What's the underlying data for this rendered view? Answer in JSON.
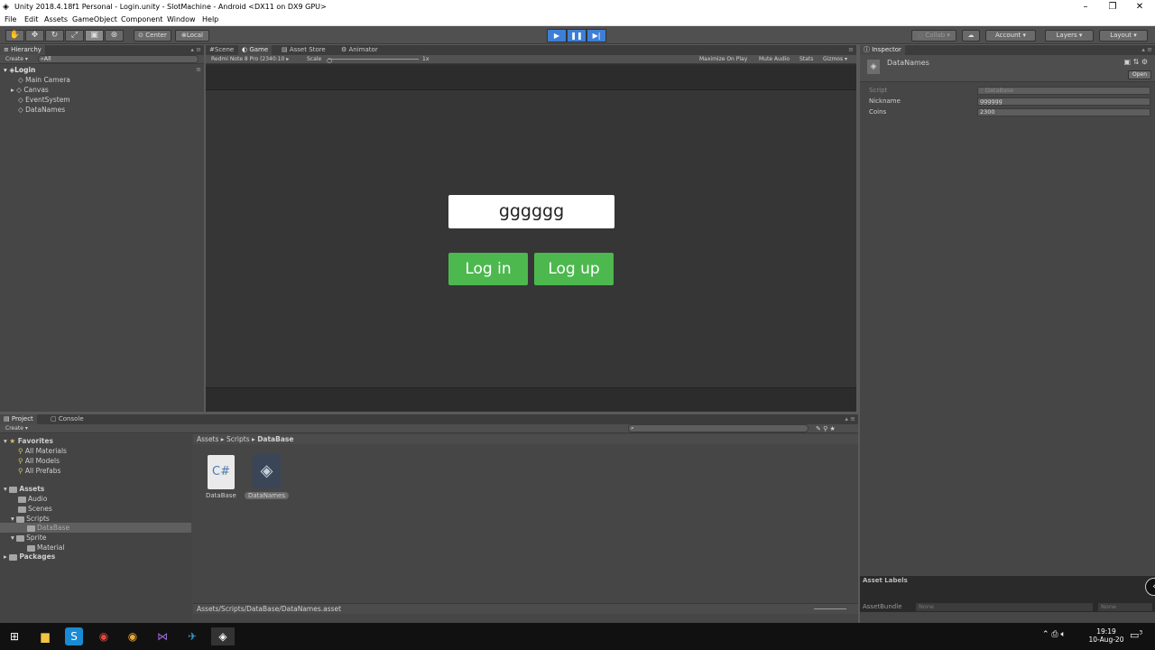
{
  "window": {
    "title": "Unity 2018.4.18f1 Personal - Login.unity - SlotMachine - Android <DX11 on DX9 GPU>"
  },
  "menu": [
    "File",
    "Edit",
    "Assets",
    "GameObject",
    "Component",
    "Window",
    "Help"
  ],
  "toolbar": {
    "center": "Center",
    "local": "Local",
    "collab": "Collab",
    "account": "Account",
    "layers": "Layers",
    "layout": "Layout"
  },
  "hierarchy": {
    "tab": "Hierarchy",
    "create": "Create",
    "search_placeholder": "All",
    "scene": "Login",
    "items": [
      "Main Camera",
      "Canvas",
      "EventSystem",
      "DataNames"
    ]
  },
  "center_tabs": [
    "Scene",
    "Game",
    "Asset Store",
    "Animator"
  ],
  "gamebar": {
    "device": "Redmi Note 8 Pro (2340:10",
    "scale_label": "Scale",
    "scale_value": "1x",
    "maximize": "Maximize On Play",
    "mute": "Mute Audio",
    "stats": "Stats",
    "gizmos": "Gizmos"
  },
  "game": {
    "nickname": "gggggg",
    "login": "Log in",
    "logup": "Log up"
  },
  "inspector": {
    "tab": "Inspector",
    "object": "DataNames",
    "open": "Open",
    "fields": [
      {
        "label": "Script",
        "value": "DataBase"
      },
      {
        "label": "Nickname",
        "value": "gggggg"
      },
      {
        "label": "Coins",
        "value": "2300"
      }
    ],
    "asset_labels": "Asset Labels",
    "asset_bundle": "AssetBundle",
    "bundle_none": "None",
    "bundle_variant": "None"
  },
  "project": {
    "tab": "Project",
    "console_tab": "Console",
    "create": "Create",
    "favorites": "Favorites",
    "fav_items": [
      "All Materials",
      "All Models",
      "All Prefabs"
    ],
    "assets": "Assets",
    "asset_tree": [
      "Audio",
      "Scenes",
      "Scripts",
      "DataBase",
      "Sprite",
      "Material"
    ],
    "packages": "Packages",
    "breadcrumb": [
      "Assets",
      "Scripts",
      "DataBase"
    ],
    "files": [
      {
        "name": "DataBase",
        "icon": "C#"
      },
      {
        "name": "DataNames",
        "icon": "unity-icon"
      }
    ],
    "path": "Assets/Scripts/DataBase/DataNames.asset"
  },
  "taskbar": {
    "time": "19:19",
    "date": "10-Aug-20",
    "notifications": "3"
  }
}
